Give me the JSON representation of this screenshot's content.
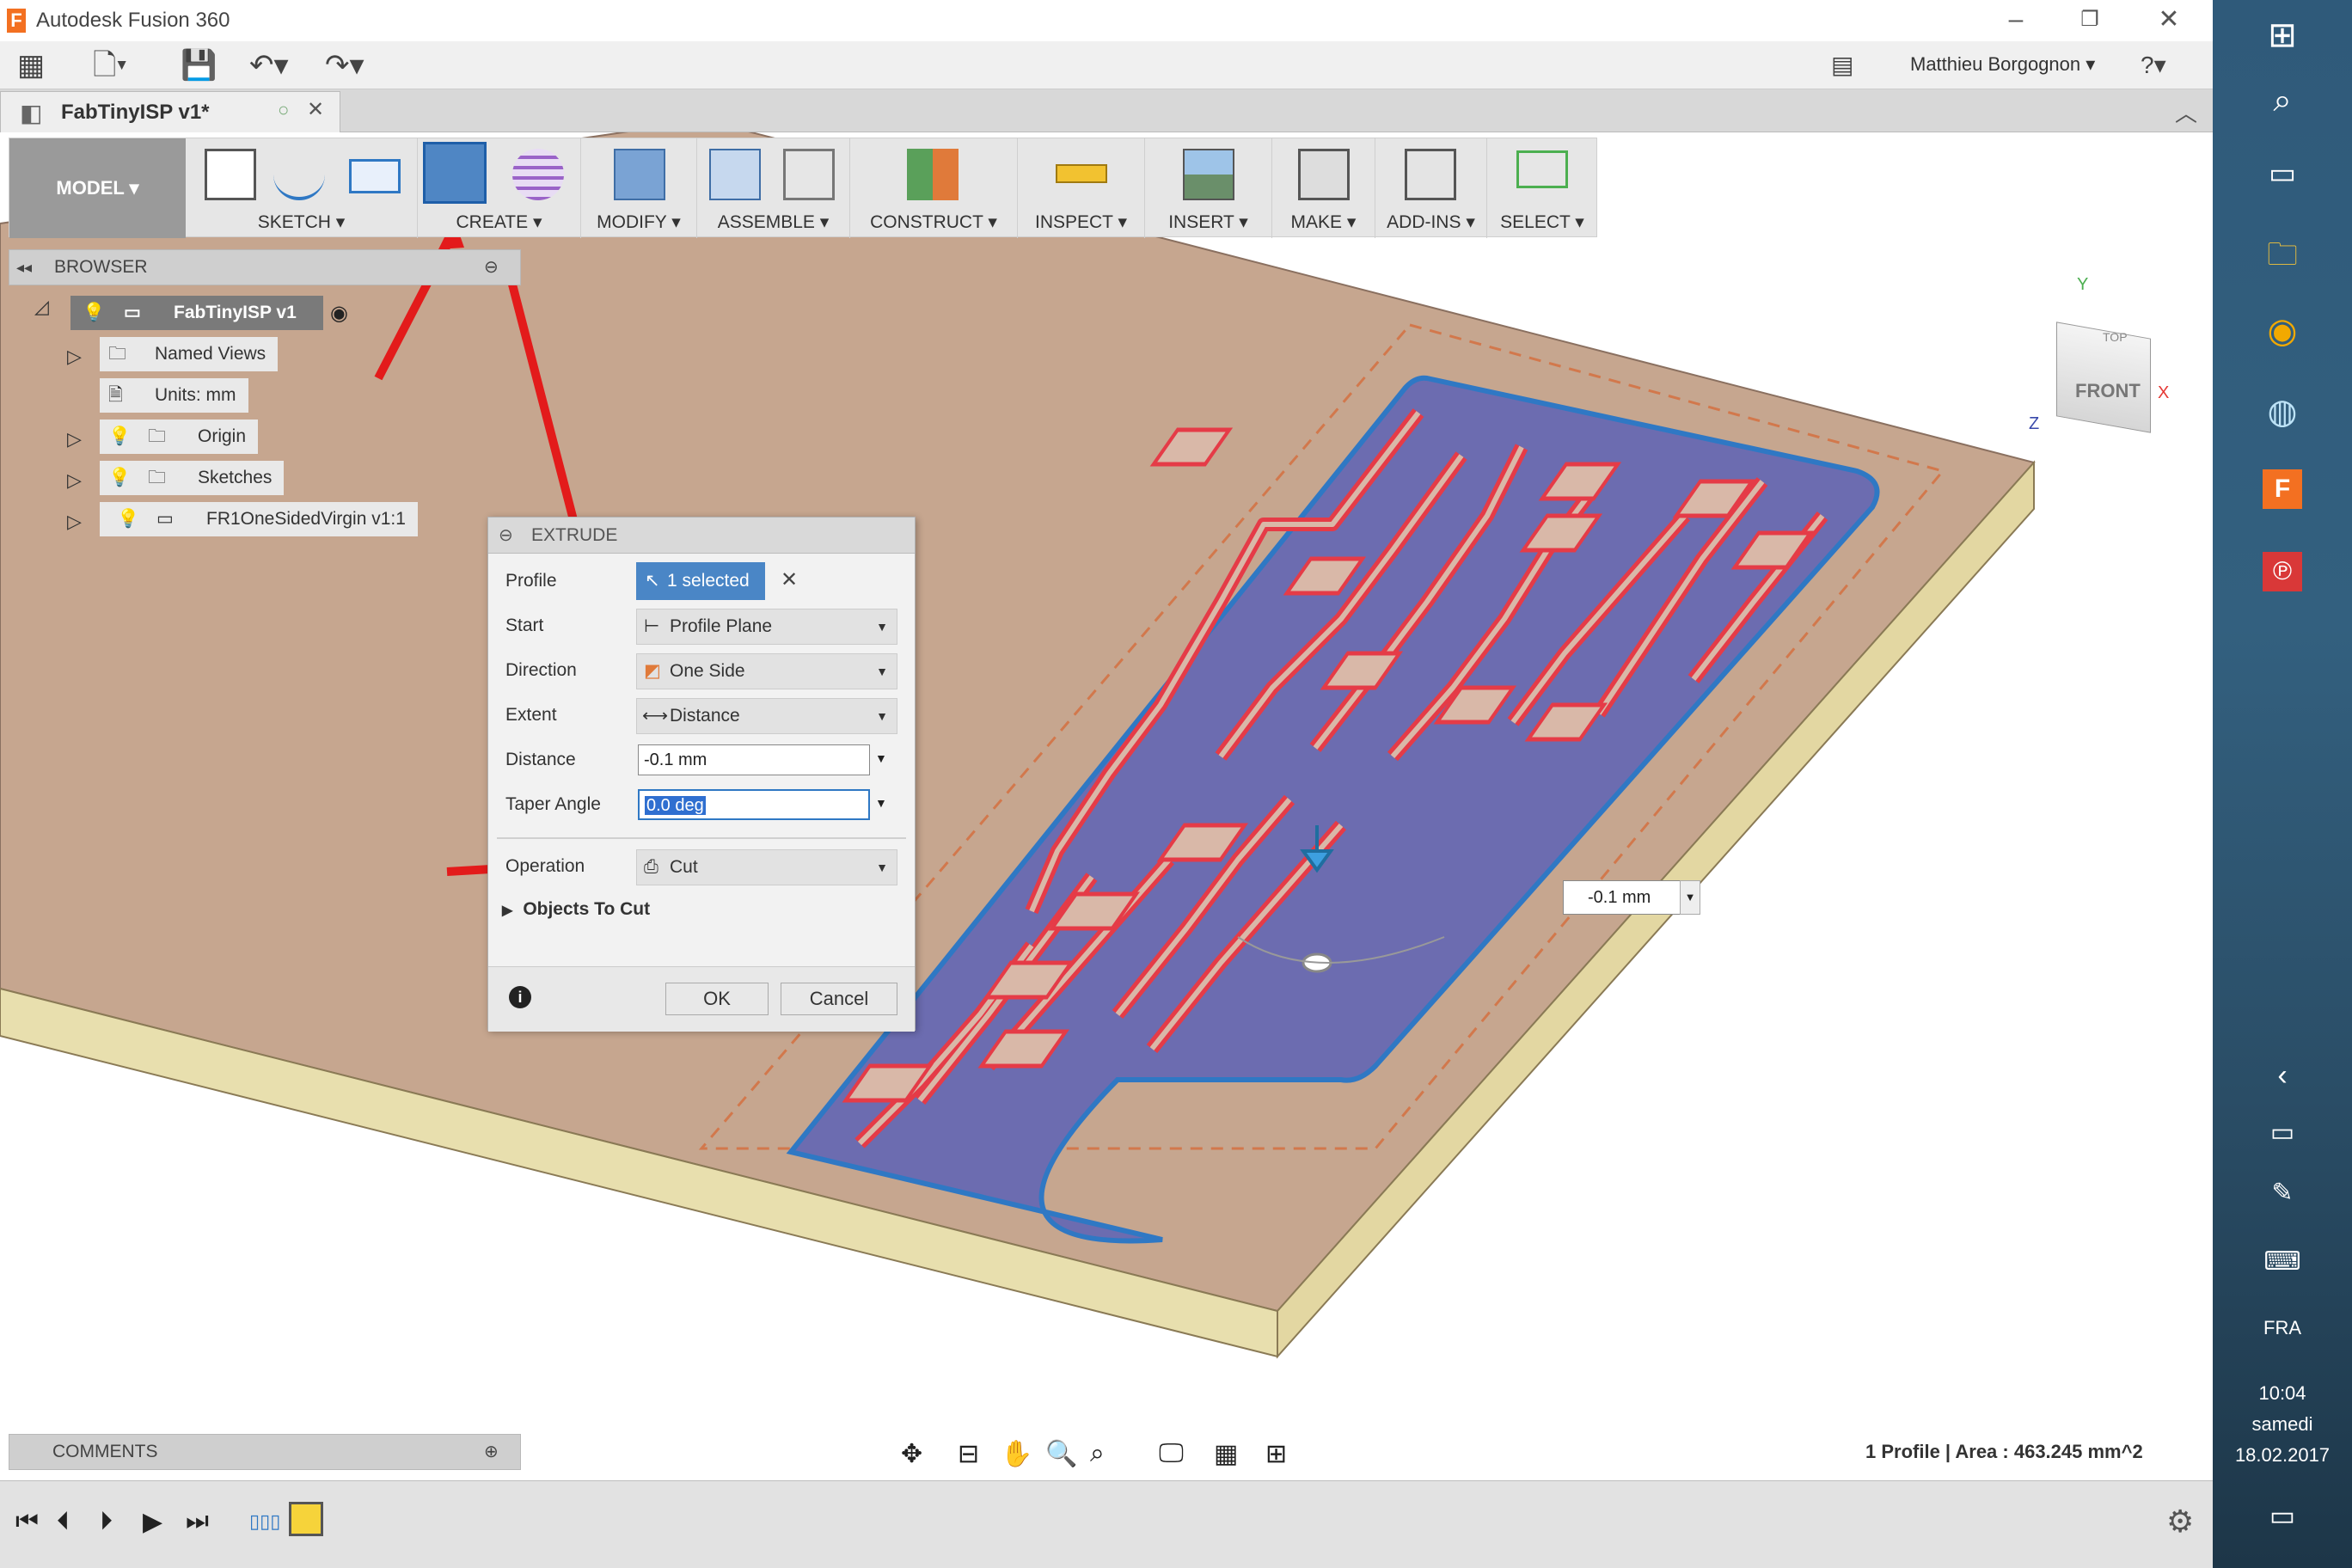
{
  "window": {
    "title": "Autodesk Fusion 360",
    "app_icon": "F"
  },
  "quick_access": {
    "user_name": "Matthieu Borgognon ▾",
    "help_label": "?"
  },
  "document_tab": {
    "name": "FabTinyISP v1*"
  },
  "toolbar": {
    "workspace": "MODEL ▾",
    "groups": [
      "SKETCH ▾",
      "CREATE ▾",
      "MODIFY ▾",
      "ASSEMBLE ▾",
      "CONSTRUCT ▾",
      "INSPECT ▾",
      "INSERT ▾",
      "MAKE ▾",
      "ADD-INS ▾",
      "SELECT ▾"
    ]
  },
  "view_cube": {
    "top": "TOP",
    "front": "FRONT",
    "axis_x": "X",
    "axis_y": "Y",
    "axis_z": "Z"
  },
  "browser": {
    "title": "BROWSER",
    "root": "FabTinyISP v1",
    "items": [
      "Named Views",
      "Units: mm",
      "Origin",
      "Sketches",
      "FR1OneSidedVirgin v1:1"
    ]
  },
  "extrude_dialog": {
    "title": "EXTRUDE",
    "rows": {
      "profile": {
        "label": "Profile",
        "value": "1 selected"
      },
      "start": {
        "label": "Start",
        "value": "Profile Plane"
      },
      "direction": {
        "label": "Direction",
        "value": "One Side"
      },
      "extent": {
        "label": "Extent",
        "value": "Distance"
      },
      "distance": {
        "label": "Distance",
        "value": "-0.1 mm"
      },
      "taper": {
        "label": "Taper Angle",
        "value": "0.0 deg"
      },
      "operation": {
        "label": "Operation",
        "value": "Cut"
      }
    },
    "objects_to_cut": "Objects To Cut",
    "ok": "OK",
    "cancel": "Cancel"
  },
  "canvas": {
    "distance_input": "-0.1 mm"
  },
  "comments": {
    "title": "COMMENTS"
  },
  "status": {
    "text": "1 Profile | Area : 463.245 mm^2"
  },
  "taskbar": {
    "language": "FRA",
    "time": "10:04",
    "day": "samedi",
    "date": "18.02.2017"
  },
  "colors": {
    "board": "#c6a68f",
    "board_side": "#e8dfae",
    "copper_area": "#6c6cb0",
    "trace_outline": "#e53b47",
    "pad": "#d9b8a8",
    "accent": "#2f78c4"
  }
}
